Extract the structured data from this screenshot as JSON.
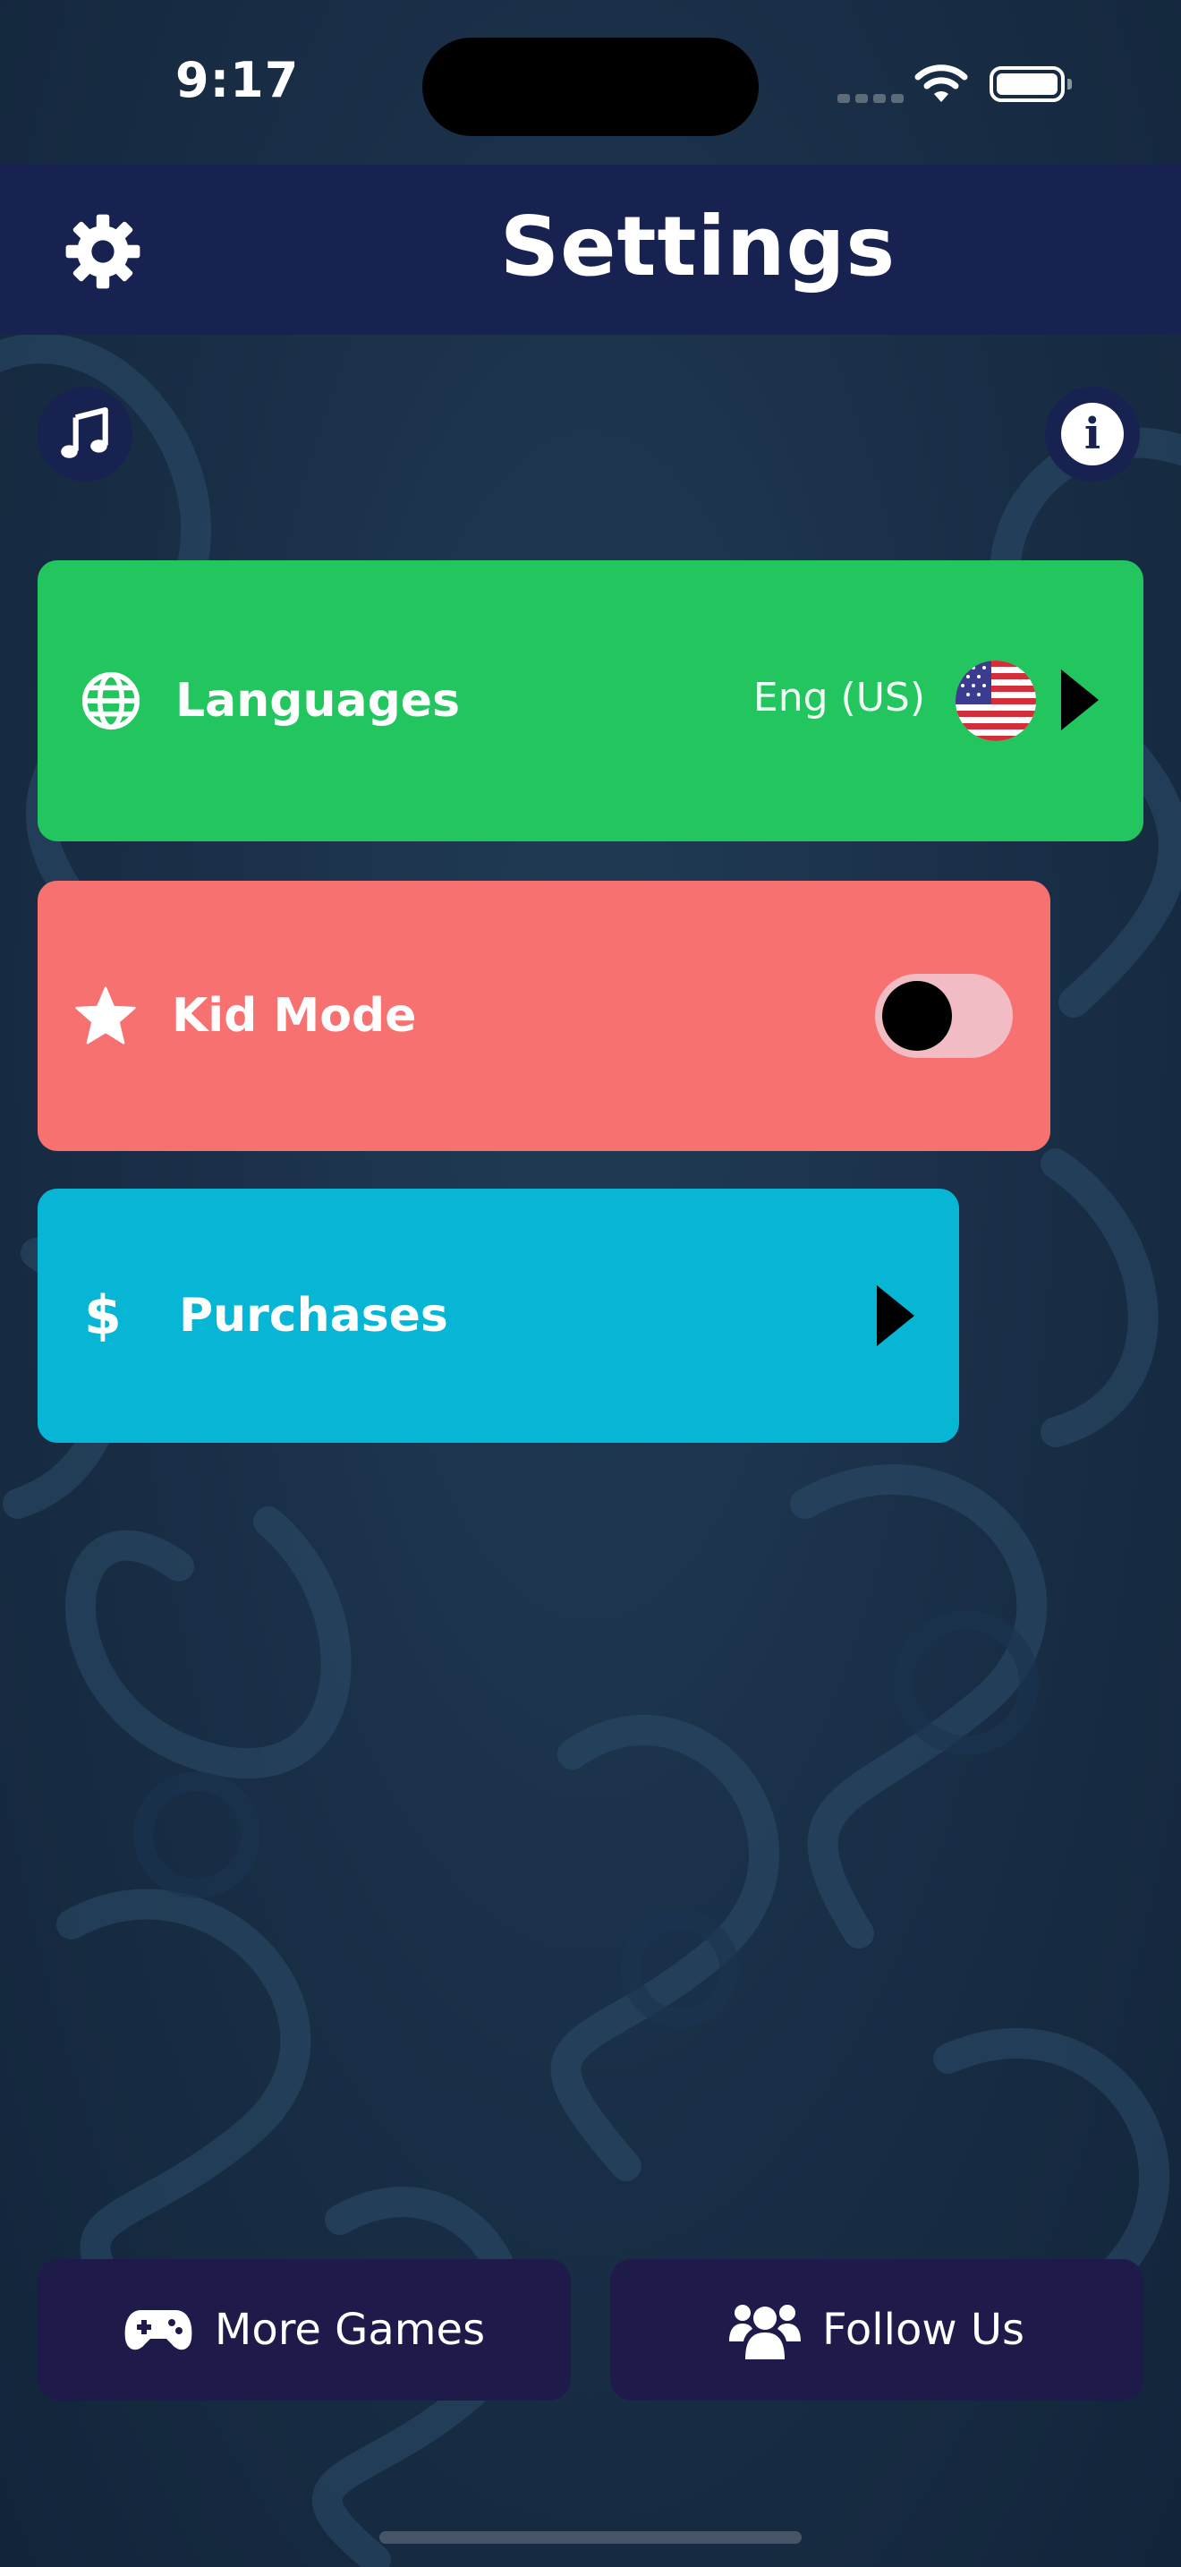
{
  "status_bar": {
    "time": "9:17"
  },
  "header": {
    "title": "Settings"
  },
  "icons": {
    "settings": "gear-icon",
    "music": "music-note-icon",
    "info": "info-icon",
    "languages": "globe-icon",
    "kid_mode": "star-icon",
    "purchases": "dollar-icon",
    "more_games": "gamepad-icon",
    "follow_us": "users-icon"
  },
  "info_glyph": "i",
  "purchases_glyph": "$",
  "cards": {
    "languages": {
      "label": "Languages",
      "value": "Eng (US)",
      "color": "#22c55e"
    },
    "kid_mode": {
      "label": "Kid Mode",
      "toggle_on": false,
      "color": "#f87171"
    },
    "purchases": {
      "label": "Purchases",
      "color": "#06b6d4"
    }
  },
  "footer": {
    "more_games_label": "More Games",
    "follow_us_label": "Follow Us"
  },
  "colors": {
    "header": "#182250",
    "background": "#1a3048",
    "footer_button": "#1e1b4b"
  }
}
